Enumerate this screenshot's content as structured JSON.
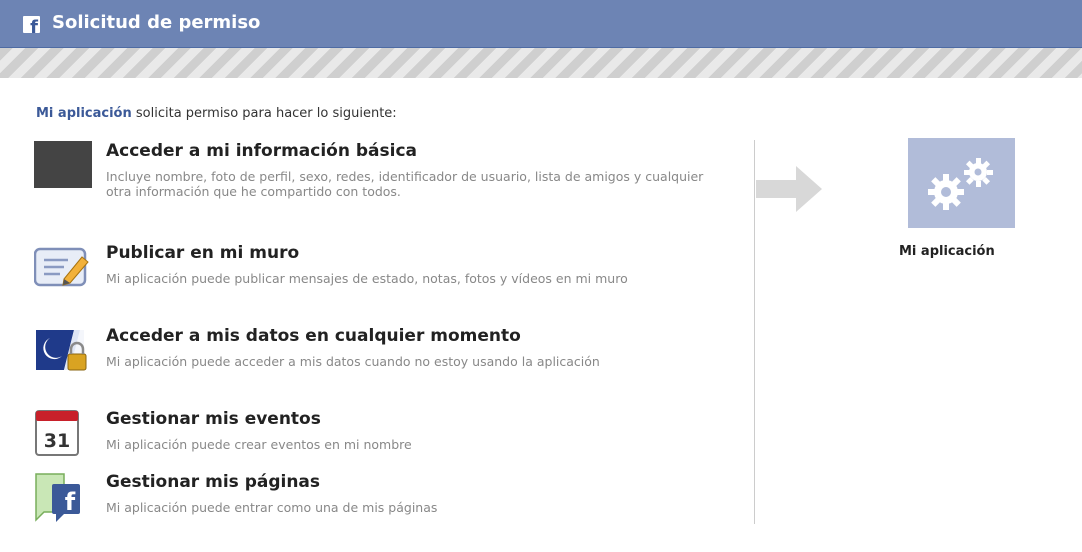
{
  "dialog": {
    "title": "Solicitud de permiso",
    "logo_letter": "f"
  },
  "intro": {
    "app_link": "Mi aplicación",
    "text": " solicita permiso para hacer lo siguiente:"
  },
  "permissions": [
    {
      "icon": "basic-info-icon",
      "title": "Acceder a mi información básica",
      "description": "Incluye nombre, foto de perfil, sexo, redes, identificador de usuario, lista de amigos y cualquier otra información que he compartido con todos."
    },
    {
      "icon": "wall-post-icon",
      "title": "Publicar en mi muro",
      "description": "Mi aplicación puede publicar mensajes de estado, notas, fotos y vídeos en mi muro"
    },
    {
      "icon": "offline-access-icon",
      "title": "Acceder a mis datos en cualquier momento",
      "description": "Mi aplicación puede acceder a mis datos cuando no estoy usando la aplicación"
    },
    {
      "icon": "calendar-icon",
      "title": "Gestionar mis eventos",
      "description": "Mi aplicación puede crear eventos en mi nombre",
      "icon_text": "31"
    },
    {
      "icon": "pages-icon",
      "title": "Gestionar mis páginas",
      "description": "Mi aplicación puede entrar como una de mis páginas",
      "icon_text": "f"
    }
  ],
  "app": {
    "name": "Mi aplicación",
    "image_icon": "gears-icon"
  },
  "colors": {
    "header": "#6d84b4",
    "link": "#3b5998",
    "app_image_bg": "#b1bcd9"
  }
}
